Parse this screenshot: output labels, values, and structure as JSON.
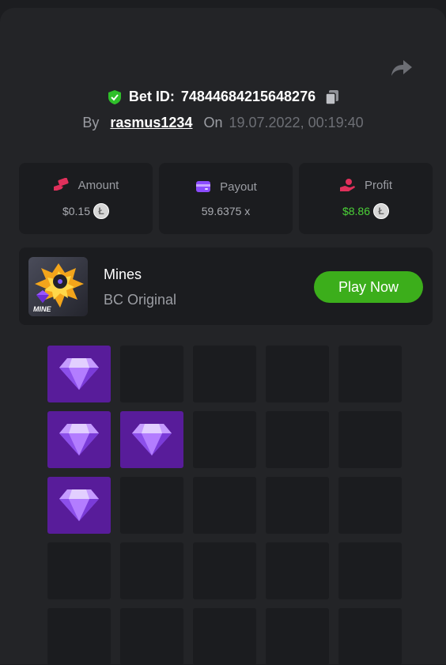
{
  "header": {
    "bet_id_label": "Bet ID:",
    "bet_id": "74844684215648276",
    "by_label": "By",
    "username": "rasmus1234",
    "on_label": "On",
    "date": "19.07.2022, 00:19:40"
  },
  "stats": [
    {
      "label": "Amount",
      "value": "$0.15",
      "icon": "money-hand-icon",
      "has_coin": true
    },
    {
      "label": "Payout",
      "value": "59.6375 x",
      "icon": "wallet-icon",
      "has_coin": false
    },
    {
      "label": "Profit",
      "value": "$8.86",
      "icon": "profit-hand-icon",
      "has_coin": true
    }
  ],
  "coin_symbol": "Ł",
  "game": {
    "title": "Mines",
    "subtitle": "BC Original",
    "thumb_label": "MINE",
    "play_label": "Play Now"
  },
  "grid": {
    "columns": 5,
    "revealed_gems": [
      [
        0,
        0
      ],
      [
        1,
        0
      ],
      [
        1,
        1
      ],
      [
        2,
        0
      ]
    ],
    "visible_rows": 5
  },
  "colors": {
    "accent_green": "#3cae1b",
    "profit_green": "#4bd137",
    "gem_tile": "#581c9a"
  }
}
